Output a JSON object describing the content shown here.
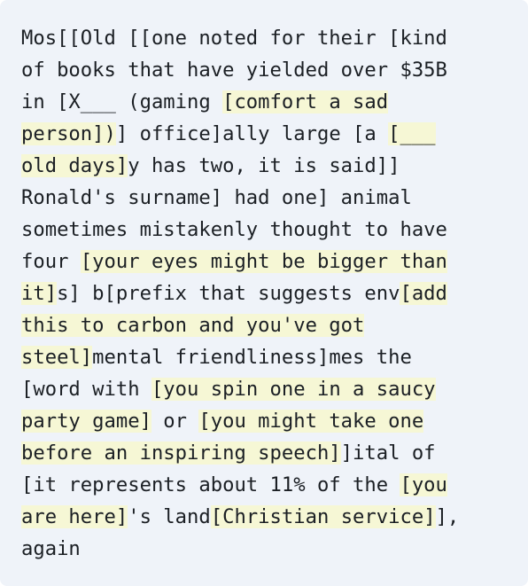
{
  "puzzle": {
    "lines": [
      [
        {
          "t": "Mos[[Old [[one noted for their [kind",
          "h": false
        }
      ],
      [
        {
          "t": "of books that have yielded over $35B",
          "h": false
        }
      ],
      [
        {
          "t": "in [X___ (gaming ",
          "h": false
        },
        {
          "t": "[comfort a sad",
          "h": true
        }
      ],
      [
        {
          "t": "person])",
          "h": true
        },
        {
          "t": "] office]ally large [a ",
          "h": false
        },
        {
          "t": "[___",
          "h": true
        }
      ],
      [
        {
          "t": "old days]",
          "h": true
        },
        {
          "t": "y has two, it is said]]",
          "h": false
        }
      ],
      [
        {
          "t": "Ronald's surname] had one] animal",
          "h": false
        }
      ],
      [
        {
          "t": "sometimes mistakenly thought to have",
          "h": false
        }
      ],
      [
        {
          "t": "four ",
          "h": false
        },
        {
          "t": "[your eyes might be bigger than",
          "h": true
        }
      ],
      [
        {
          "t": "it]",
          "h": true
        },
        {
          "t": "s] b[prefix that suggests env",
          "h": false
        },
        {
          "t": "[add",
          "h": true
        }
      ],
      [
        {
          "t": "this to carbon and you've got",
          "h": true
        }
      ],
      [
        {
          "t": "steel]",
          "h": true
        },
        {
          "t": "mental friendliness]mes the",
          "h": false
        }
      ],
      [
        {
          "t": "[word with ",
          "h": false
        },
        {
          "t": "[you spin one in a saucy",
          "h": true
        }
      ],
      [
        {
          "t": "party game]",
          "h": true
        },
        {
          "t": " or ",
          "h": false
        },
        {
          "t": "[you might take one",
          "h": true
        }
      ],
      [
        {
          "t": "before an inspiring speech]",
          "h": true
        },
        {
          "t": "]ital of",
          "h": false
        }
      ],
      [
        {
          "t": "[it represents about 11% of the ",
          "h": false
        },
        {
          "t": "[you",
          "h": true
        }
      ],
      [
        {
          "t": "are here]",
          "h": true
        },
        {
          "t": "'s land",
          "h": false
        },
        {
          "t": "[Christian service]",
          "h": true
        },
        {
          "t": "],",
          "h": false
        }
      ],
      [
        {
          "t": "again",
          "h": false
        }
      ]
    ]
  },
  "colors": {
    "background": "#eff3f9",
    "highlight": "#f6f7d5",
    "text": "#1b1f24"
  }
}
